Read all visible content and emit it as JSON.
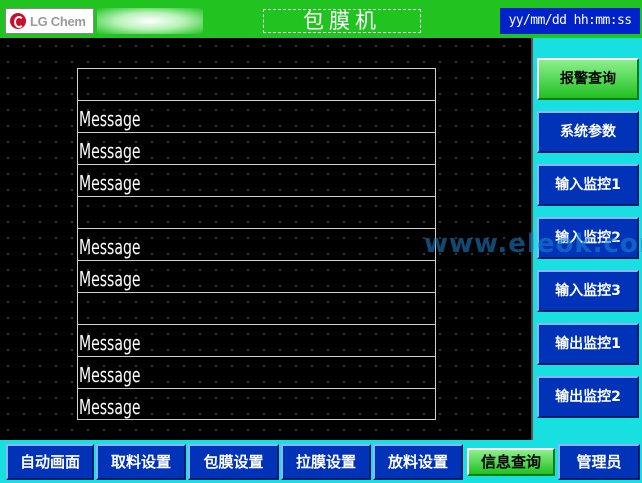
{
  "header": {
    "logo_text": "LG Chem",
    "title": "包膜机",
    "datetime": "yy/mm/dd hh:mm:ss"
  },
  "alarm_list": {
    "rows": [
      "",
      "Message",
      "Message",
      "Message",
      "",
      "Message",
      "Message",
      "",
      "Message",
      "Message",
      "Message"
    ]
  },
  "sidebar": {
    "buttons": [
      {
        "label": "报警查询",
        "active": true
      },
      {
        "label": "系统参数",
        "active": false
      },
      {
        "label": "输入监控1",
        "active": false
      },
      {
        "label": "输入监控2",
        "active": false
      },
      {
        "label": "输入监控3",
        "active": false
      },
      {
        "label": "输出监控1",
        "active": false
      },
      {
        "label": "输出监控2",
        "active": false
      }
    ]
  },
  "bottom_nav": {
    "buttons": [
      {
        "label": "自动画面",
        "active": false
      },
      {
        "label": "取料设置",
        "active": false
      },
      {
        "label": "包膜设置",
        "active": false
      },
      {
        "label": "拉膜设置",
        "active": false
      },
      {
        "label": "放料设置",
        "active": false
      },
      {
        "label": "信息查询",
        "active": true
      },
      {
        "label": "管理员",
        "active": false
      }
    ]
  },
  "watermark": "www.eleok.com",
  "colors": {
    "header_green": "#21c321",
    "button_blue": "#0033b8",
    "panel_cyan": "#18e0e0",
    "active_green": "#22c022"
  }
}
